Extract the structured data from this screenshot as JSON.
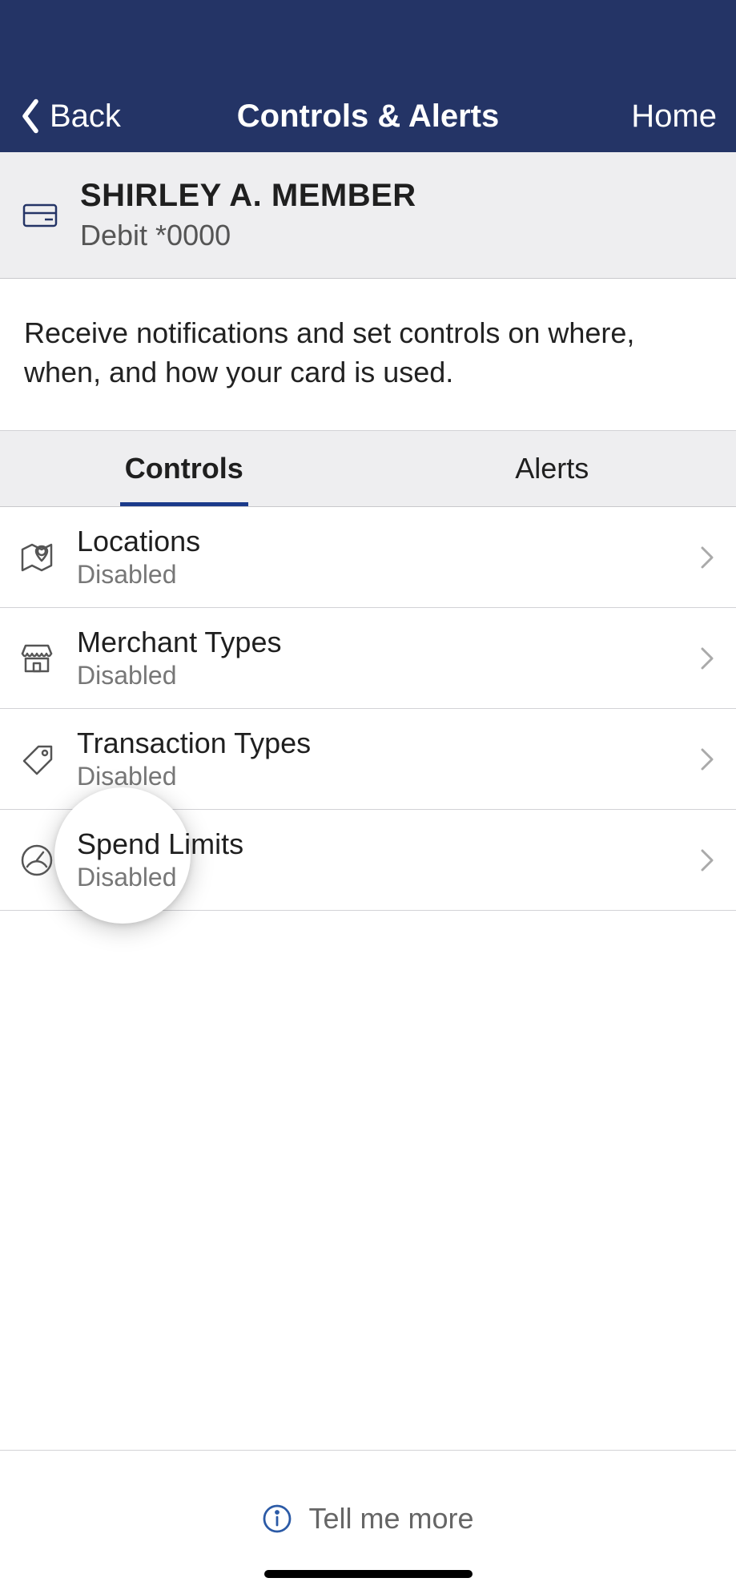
{
  "nav": {
    "back_label": "Back",
    "title": "Controls & Alerts",
    "home_label": "Home"
  },
  "card": {
    "holder": "SHIRLEY A. MEMBER",
    "sub": "Debit *0000"
  },
  "description": "Receive notifications and set controls on where, when, and how your card is used.",
  "tabs": {
    "controls": "Controls",
    "alerts": "Alerts"
  },
  "items": [
    {
      "title": "Locations",
      "status": "Disabled"
    },
    {
      "title": "Merchant Types",
      "status": "Disabled"
    },
    {
      "title": "Transaction Types",
      "status": "Disabled"
    },
    {
      "title": "Spend Limits",
      "status": "Disabled"
    }
  ],
  "footer": {
    "tell_me_more": "Tell me more"
  },
  "colors": {
    "navy": "#243466",
    "accent": "#1b3a8a",
    "muted": "#777"
  }
}
